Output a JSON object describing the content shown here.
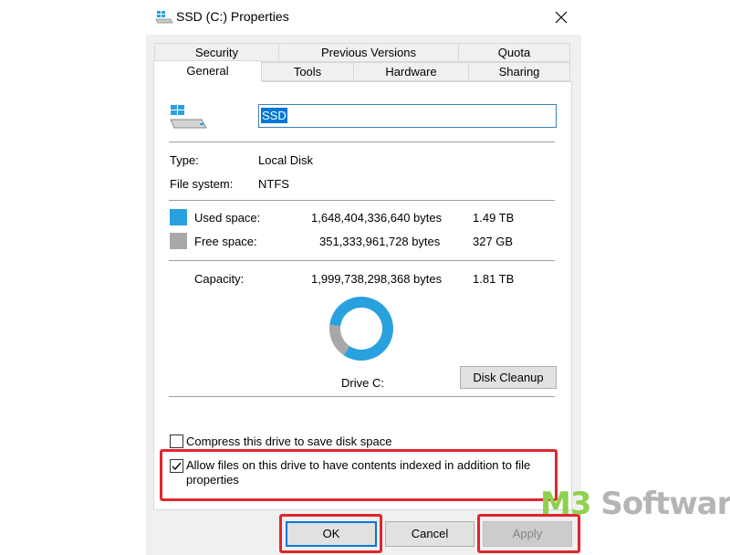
{
  "window": {
    "title": "SSD (C:) Properties"
  },
  "tabs_back": [
    {
      "label": "Security"
    },
    {
      "label": "Previous Versions"
    },
    {
      "label": "Quota"
    }
  ],
  "tabs_front": [
    {
      "label": "General",
      "active": true
    },
    {
      "label": "Tools"
    },
    {
      "label": "Hardware"
    },
    {
      "label": "Sharing"
    }
  ],
  "general": {
    "drive_name": "SSD",
    "type_label": "Type:",
    "type_value": "Local Disk",
    "fs_label": "File system:",
    "fs_value": "NTFS",
    "used": {
      "label": "Used space:",
      "bytes": "1,648,404,336,640 bytes",
      "size": "1.49 TB",
      "color": "#2aa1df"
    },
    "free": {
      "label": "Free space:",
      "bytes": "351,333,961,728 bytes",
      "size": "327 GB",
      "color": "#a8a8a8"
    },
    "capacity": {
      "label": "Capacity:",
      "bytes": "1,999,738,298,368 bytes",
      "size": "1.81 TB"
    },
    "used_fraction": 0.8243,
    "drive_label": "Drive C:",
    "disk_cleanup": "Disk Cleanup",
    "compress_label": "Compress this drive to save disk space",
    "compress_checked": false,
    "index_label_line1": "Allow files on this drive to have contents indexed in addition to file",
    "index_label_line2": "properties",
    "index_checked": true
  },
  "buttons": {
    "ok": "OK",
    "cancel": "Cancel",
    "apply": "Apply"
  },
  "watermark": {
    "brand_a": "M3",
    "brand_b": " Software"
  },
  "icons": {
    "title": "drive-icon",
    "close": "close-icon",
    "drive": "windows-drive-icon",
    "check": "checkmark-icon"
  }
}
